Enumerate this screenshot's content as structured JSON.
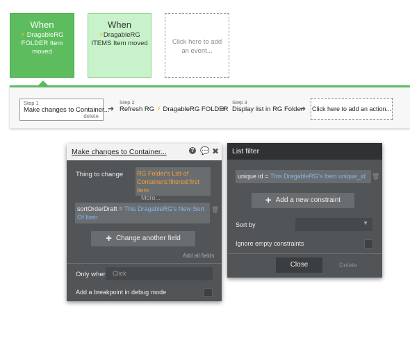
{
  "events": [
    {
      "when": "When",
      "text": "DragableRG FOLDER Item moved"
    },
    {
      "when": "When",
      "text": "DragableRG ITEMS Item moved"
    },
    {
      "text": "Click here to add an event..."
    }
  ],
  "workflow": {
    "steps": [
      {
        "num": "Step 1",
        "title": "Make changes to Container...",
        "delete": "delete"
      },
      {
        "num": "Step 2",
        "title_prefix": "Refresh RG",
        "title_suffix": "DragableRG FOLDER"
      },
      {
        "num": "Step 3",
        "title": "Display list in RG Folder"
      }
    ],
    "add_action": "Click here to add an action..."
  },
  "left_panel": {
    "title": "Make changes to Container...",
    "thing_label": "Thing to change",
    "thing_value": "RG Folder's List of Containers:filtered:first item",
    "more": "More...",
    "field_name": "sortOrderDraft =",
    "field_value": "This DragableRG's New Sort Of Item",
    "change_field_btn": "Change another field",
    "add_all_fields": "Add all fields",
    "only_when_label": "Only when",
    "only_when_placeholder": "Click",
    "breakpoint_label": "Add a breakpoint in debug mode"
  },
  "right_panel": {
    "title": "List filter",
    "constraint_field": "unique id =",
    "constraint_value": "This DragableRG's Item unique_id",
    "add_constraint_btn": "Add a new constraint",
    "sort_by_label": "Sort by",
    "sort_by_value": "",
    "ignore_empty_label": "Ignore empty constraints",
    "close_btn": "Close",
    "delete_btn": "Delete"
  },
  "colors": {
    "accent_green": "#5cbc5e",
    "light_green": "#c8f2c9",
    "dynamic_orange": "#f0a03a",
    "dynamic_blue": "#7fb7ec",
    "panel_bg": "#525558"
  }
}
